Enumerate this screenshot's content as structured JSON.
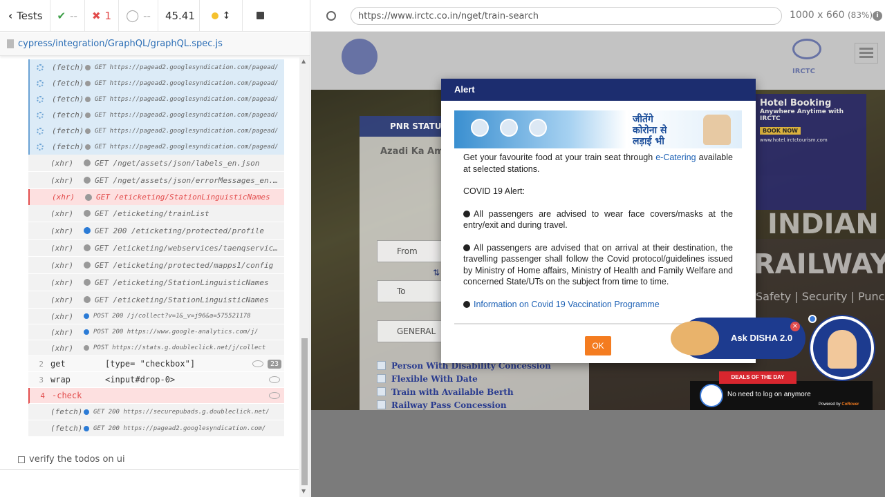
{
  "reporter": {
    "tests_label": "Tests",
    "passed": "--",
    "failed": "1",
    "pending": "--",
    "duration": "45.41",
    "spec_path": "cypress/integration/GraphQL/graphQL.spec.js",
    "commands": [
      {
        "name": "(fetch)",
        "msg": "GET https://pagead2.googlesyndication.com/pagead/",
        "kind": "fetch"
      },
      {
        "name": "(fetch)",
        "msg": "GET https://pagead2.googlesyndication.com/pagead/",
        "kind": "fetch"
      },
      {
        "name": "(fetch)",
        "msg": "GET https://pagead2.googlesyndication.com/pagead/",
        "kind": "fetch"
      },
      {
        "name": "(fetch)",
        "msg": "GET https://pagead2.googlesyndication.com/pagead/",
        "kind": "fetch"
      },
      {
        "name": "(fetch)",
        "msg": "GET https://pagead2.googlesyndication.com/pagead/",
        "kind": "fetch"
      },
      {
        "name": "(fetch)",
        "msg": "GET https://pagead2.googlesyndication.com/pagead/",
        "kind": "fetch"
      },
      {
        "name": "(xhr)",
        "msg": "GET /nget/assets/json/labels_en.json",
        "kind": "xhr"
      },
      {
        "name": "(xhr)",
        "msg": "GET /nget/assets/json/errorMessages_en.json",
        "kind": "xhr"
      },
      {
        "name": "(xhr)",
        "msg": "GET /eticketing/StationLinguisticNames",
        "kind": "xhr-red"
      },
      {
        "name": "(xhr)",
        "msg": "GET /eticketing/trainList",
        "kind": "xhr"
      },
      {
        "name": "(xhr)",
        "msg": "GET 200 /eticketing/protected/profile",
        "kind": "xhr-blue"
      },
      {
        "name": "(xhr)",
        "msg": "GET /eticketing/webservices/taenqservices",
        "kind": "xhr"
      },
      {
        "name": "(xhr)",
        "msg": "GET /eticketing/protected/mapps1/config",
        "kind": "xhr"
      },
      {
        "name": "(xhr)",
        "msg": "GET /eticketing/StationLinguisticNames",
        "kind": "xhr"
      },
      {
        "name": "(xhr)",
        "msg": "GET /eticketing/StationLinguisticNames",
        "kind": "xhr"
      },
      {
        "name": "(xhr)",
        "msg": "POST 200 /j/collect?v=1&_v=j96&a=575521178",
        "kind": "xhr-post"
      },
      {
        "name": "(xhr)",
        "msg": "POST 200 https://www.google-analytics.com/j/",
        "kind": "xhr-post"
      },
      {
        "name": "(xhr)",
        "msg": "POST https://stats.g.doubleclick.net/j/collect",
        "kind": "xhr-post-grey"
      }
    ],
    "steps": [
      {
        "num": "2",
        "name": "get",
        "msg": "[type= \"checkbox\"]",
        "badge": "23"
      },
      {
        "num": "3",
        "name": "wrap",
        "msg": "<input#drop-0>"
      },
      {
        "num": "4",
        "name": "-check",
        "msg": ""
      }
    ],
    "tail": [
      {
        "name": "(fetch)",
        "msg": "GET 200 https://securepubads.g.doubleclick.net/"
      },
      {
        "name": "(fetch)",
        "msg": "GET 200 https://pagead2.googlesyndication.com/"
      }
    ],
    "test_title": "verify the todos on ui"
  },
  "browser": {
    "url": "https://www.irctc.co.in/nget/train-search",
    "viewport": "1000 x 660",
    "zoom": "(83%)"
  },
  "site": {
    "pnr_label": "PNR STATUS",
    "azadi_label": "Azadi Ka Amrit Mahot",
    "from_label": "From",
    "to_label": "To",
    "general_label": "GENERAL",
    "options": [
      "Person With Disability Concession",
      "Flexible With Date",
      "Train with Available Berth",
      "Railway Pass Concession"
    ],
    "hotel_title": "Hotel Booking",
    "hotel_sub": "Anywhere Anytime with IRCTC",
    "hotel_btn": "BOOK NOW",
    "hotel_url": "www.hotel.irctctourism.com",
    "indian": "INDIAN",
    "railways": "RAILWAYS",
    "tagline": "Safety | Security | Punc",
    "irctc_logo": "IRCTC"
  },
  "alert": {
    "title": "Alert",
    "banner_hindi_1": "जीतेंगे",
    "banner_hindi_2": "कोरोना से",
    "banner_hindi_3": "लड़ाई भी",
    "food_text": "Get your favourite food at your train seat through ",
    "food_link": "e-Catering",
    "food_tail": " available at selected stations.",
    "covid_title": "COVID 19 Alert:",
    "bullet1": "All passengers are advised to wear face covers/masks at the entry/exit and during travel.",
    "bullet2": "All passengers are advised that on arrival at their destination, the travelling passenger shall follow the Covid protocol/guidelines issued by Ministry of Home affairs, Ministry of Health and Family Welfare and concerned State/UTs on the subject from time to time.",
    "vaccine_link": "Information on Covid 19 Vaccination Programme",
    "ok_label": "OK"
  },
  "disha": {
    "label": "Ask DISHA 2.0",
    "close": "×",
    "deals": "DEALS OF THE DAY",
    "deals_text": "No need to log on anymore",
    "powered": "Powered by",
    "powered_brand": "CoRover"
  }
}
